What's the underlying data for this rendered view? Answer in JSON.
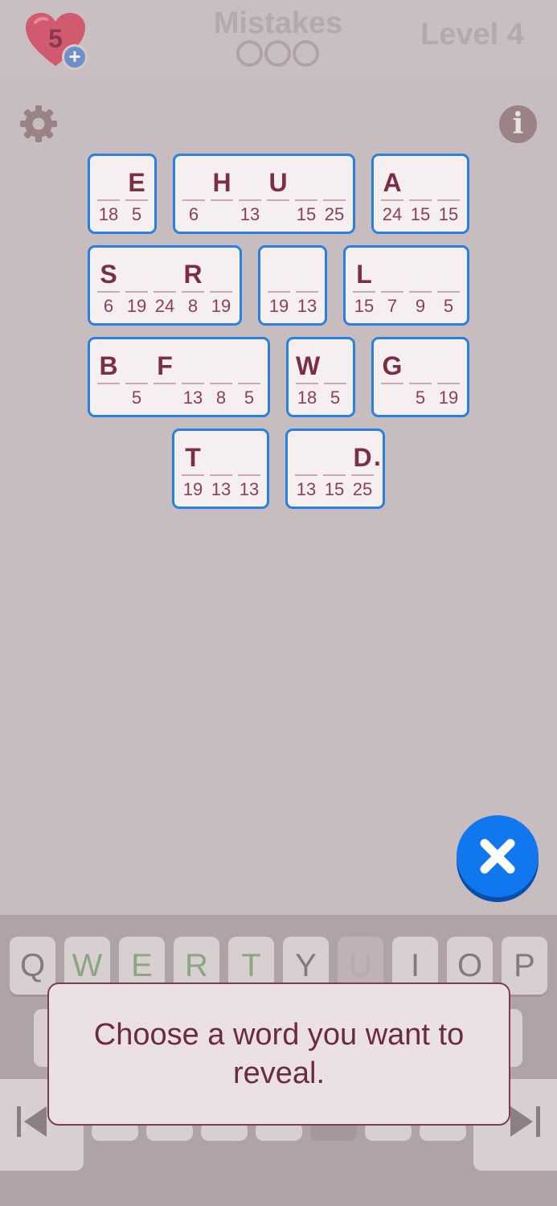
{
  "header": {
    "lives": "5",
    "add_lives_label": "+",
    "mistakes_label": "Mistakes",
    "level_label": "Level 4",
    "info_label": "i"
  },
  "colors": {
    "background": "#c7bcbe",
    "tile_border": "#2a80e0",
    "tile_fill": "#f5f0ef",
    "letter": "#7a2f45",
    "heart": "#d25a6e",
    "close_button": "#1177ee",
    "key_revealed": "#8ba77f"
  },
  "icons": [
    "heart-icon",
    "plus-icon",
    "gear-icon",
    "info-icon",
    "close-icon",
    "skip-back-icon",
    "skip-forward-icon"
  ],
  "puzzle": {
    "words": [
      {
        "cells": [
          {
            "letter": "",
            "num": "18"
          },
          {
            "letter": "E",
            "num": "5"
          }
        ]
      },
      {
        "cells": [
          {
            "letter": "",
            "num": "6"
          },
          {
            "letter": "H",
            "num": ""
          },
          {
            "letter": "",
            "num": "13"
          },
          {
            "letter": "U",
            "num": ""
          },
          {
            "letter": "",
            "num": "15"
          },
          {
            "letter": "",
            "num": "25"
          }
        ]
      },
      {
        "cells": [
          {
            "letter": "A",
            "num": "24"
          },
          {
            "letter": "",
            "num": "15"
          },
          {
            "letter": "",
            "num": "15"
          }
        ]
      },
      {
        "cells": [
          {
            "letter": "S",
            "num": "6"
          },
          {
            "letter": "",
            "num": "19"
          },
          {
            "letter": "",
            "num": "24"
          },
          {
            "letter": "R",
            "num": "8"
          },
          {
            "letter": "",
            "num": "19"
          }
        ]
      },
      {
        "cells": [
          {
            "letter": "",
            "num": "19"
          },
          {
            "letter": "",
            "num": "13"
          }
        ]
      },
      {
        "cells": [
          {
            "letter": "L",
            "num": "15"
          },
          {
            "letter": "",
            "num": "7"
          },
          {
            "letter": "",
            "num": "9"
          },
          {
            "letter": "",
            "num": "5"
          }
        ]
      },
      {
        "cells": [
          {
            "letter": "B",
            "num": ""
          },
          {
            "letter": "",
            "num": "5"
          },
          {
            "letter": "F",
            "num": ""
          },
          {
            "letter": "",
            "num": "13"
          },
          {
            "letter": "",
            "num": "8"
          },
          {
            "letter": "",
            "num": "5"
          }
        ]
      },
      {
        "cells": [
          {
            "letter": "W",
            "num": "18"
          },
          {
            "letter": "",
            "num": "5"
          }
        ]
      },
      {
        "cells": [
          {
            "letter": "G",
            "num": ""
          },
          {
            "letter": "",
            "num": "5"
          },
          {
            "letter": "",
            "num": "19"
          }
        ]
      },
      {
        "cells": [
          {
            "letter": "T",
            "num": "19"
          },
          {
            "letter": "",
            "num": "13"
          },
          {
            "letter": "",
            "num": "13"
          }
        ]
      },
      {
        "cells": [
          {
            "letter": "",
            "num": "13"
          },
          {
            "letter": "",
            "num": "15"
          },
          {
            "letter": "D",
            "num": "25"
          }
        ],
        "punct": "."
      }
    ]
  },
  "keyboard": {
    "row1": [
      {
        "label": "Q",
        "state": "normal"
      },
      {
        "label": "W",
        "state": "revealed"
      },
      {
        "label": "E",
        "state": "revealed"
      },
      {
        "label": "R",
        "state": "revealed"
      },
      {
        "label": "T",
        "state": "revealed"
      },
      {
        "label": "Y",
        "state": "normal"
      },
      {
        "label": "U",
        "state": "used"
      },
      {
        "label": "I",
        "state": "normal"
      },
      {
        "label": "O",
        "state": "normal"
      },
      {
        "label": "P",
        "state": "normal"
      }
    ]
  },
  "hint": {
    "text": "Choose a word you want to reveal."
  }
}
